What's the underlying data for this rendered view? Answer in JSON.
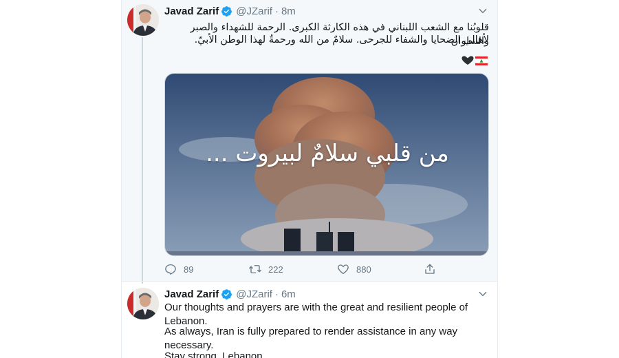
{
  "tweets": [
    {
      "name": "Javad Zarif",
      "handle": "@JZarif",
      "separator": "·",
      "time": "8m",
      "text_line1": "قلوبُنا مع الشعب اللبناني في هذه الكارثة الكبرى. الرحمة للشهداء والصبر والسلوان",
      "text_line2": "لأهالي الضحايا والشفاء للجرحى. سلامٌ من الله ورحمةٌ لهذا الوطن الأبيّ.",
      "emoji": [
        "lebanon-flag-icon",
        "black-heart-icon"
      ],
      "image_caption": "من قلبي سلامٌ لبيروت ...",
      "replies": "89",
      "retweets": "222",
      "likes": "880"
    },
    {
      "name": "Javad Zarif",
      "handle": "@JZarif",
      "separator": "·",
      "time": "6m",
      "paragraph1": "Our thoughts and prayers are with the great and resilient people of Lebanon.",
      "paragraph2": "As always, Iran is fully prepared to render assistance in any way necessary.",
      "paragraph3": "Stay strong, Lebanon."
    }
  ],
  "colors": {
    "verified": "#1da1f2",
    "muted": "#657786",
    "text": "#14171a",
    "highlight_bg": "#f5f8fa"
  }
}
